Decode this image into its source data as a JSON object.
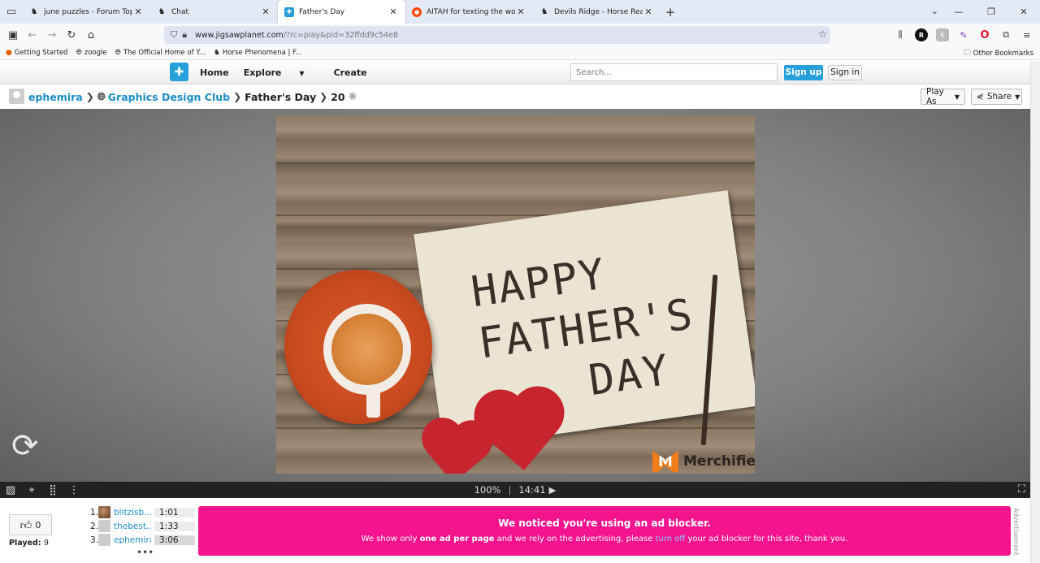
{
  "browser": {
    "tabs": [
      {
        "title": "june puzzles - Forum Topic",
        "icon": "horse-icon"
      },
      {
        "title": "Chat",
        "icon": "horse-icon"
      },
      {
        "title": "Father's Day",
        "icon": "jigsaw-icon",
        "active": true
      },
      {
        "title": "AITAH for texting the woman m",
        "icon": "reddit-icon"
      },
      {
        "title": "Devils Ridge - Horse Reality",
        "icon": "horse-icon"
      }
    ],
    "url_host": "www.jigsawplanet.com",
    "url_rest": "/?rc=play&pid=32ffdd9c54e8",
    "bookmarks": [
      {
        "label": "Getting Started",
        "icon": "firefox-icon"
      },
      {
        "label": "zoogle",
        "icon": "globe-icon"
      },
      {
        "label": "The Official Home of Y...",
        "icon": "globe-icon"
      },
      {
        "label": "Horse Phenomena | F...",
        "icon": "horse-icon"
      }
    ],
    "other_bookmarks": "Other Bookmarks"
  },
  "site": {
    "nav": {
      "home": "Home",
      "explore": "Explore",
      "create": "Create"
    },
    "search_placeholder": "Search...",
    "signup": "Sign up",
    "signin": "Sign in"
  },
  "breadcrumb": {
    "user": "ephemira",
    "club": "Graphics Design Club",
    "title": "Father's Day",
    "pieces": "20",
    "play_as": "Play As",
    "share": "Share"
  },
  "puzzle": {
    "card_lines": [
      "HAPPY",
      "FATHER'S",
      "DAY"
    ],
    "brand": "Merchifies",
    "brand_mark": "M",
    "brand_reg": "®"
  },
  "toolbar": {
    "zoom": "100%",
    "separator": "|",
    "time": "14:41"
  },
  "bottom": {
    "likes": "0",
    "played_label": "Played:",
    "played_count": "9",
    "scores": [
      {
        "rank": "1.",
        "name": "blitzisb...",
        "time": "1:01"
      },
      {
        "rank": "2.",
        "name": "thebest...",
        "time": "1:33"
      },
      {
        "rank": "3.",
        "name": "ephemira",
        "time": "3:06"
      }
    ],
    "more": "•••",
    "ad_heading": "We noticed you're using an ad blocker.",
    "ad_text_1": "We show only ",
    "ad_text_bold": "one ad per page",
    "ad_text_2": " and we rely on the advertising, please ",
    "ad_text_link": "turn off",
    "ad_text_3": " your ad blocker for this site, thank you.",
    "ad_vertical": "Advertisement"
  }
}
